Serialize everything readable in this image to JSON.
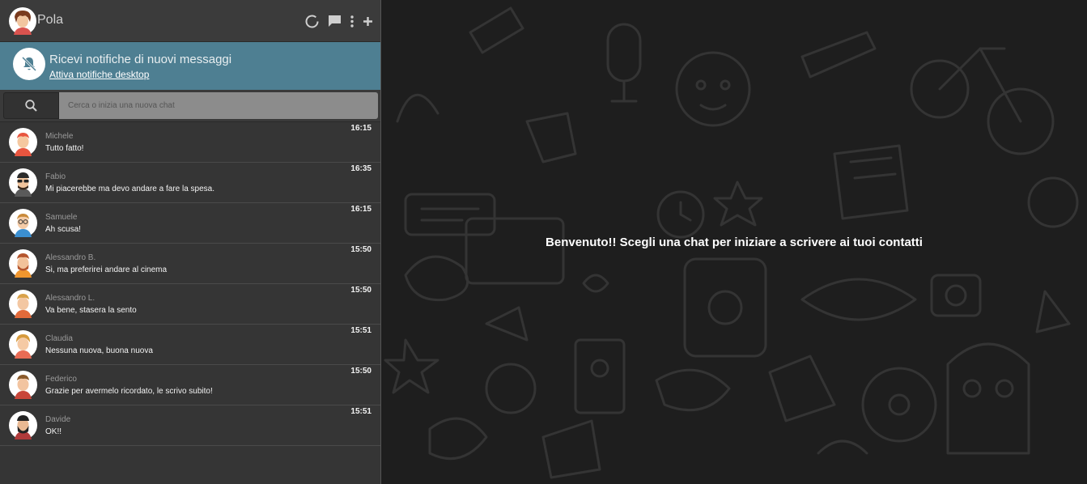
{
  "header": {
    "title": "Pola",
    "icons": [
      "status-icon",
      "chat-icon",
      "menu-icon",
      "add-icon"
    ]
  },
  "notification": {
    "title": "Ricevi notifiche di nuovi messaggi",
    "link": "Attiva notifiche desktop",
    "icon": "bell-off-icon"
  },
  "search": {
    "placeholder": "Cerca o inizia una nuova chat",
    "icon": "search-icon"
  },
  "chats": [
    {
      "name": "Michele",
      "message": "Tutto fatto!",
      "time": "16:15"
    },
    {
      "name": "Fabio",
      "message": "Mi piacerebbe ma devo andare a fare la spesa.",
      "time": "16:35"
    },
    {
      "name": "Samuele",
      "message": "Ah scusa!",
      "time": "16:15"
    },
    {
      "name": "Alessandro B.",
      "message": "Si, ma preferirei andare al cinema",
      "time": "15:50"
    },
    {
      "name": "Alessandro L.",
      "message": "Va bene, stasera la sento",
      "time": "15:50"
    },
    {
      "name": "Claudia",
      "message": "Nessuna nuova, buona nuova",
      "time": "15:51"
    },
    {
      "name": "Federico",
      "message": "Grazie per avermelo ricordato, le scrivo subito!",
      "time": "15:50"
    },
    {
      "name": "Davide",
      "message": "OK!!",
      "time": "15:51"
    }
  ],
  "main": {
    "welcome": "Benvenuto!! Scegli una chat per iniziare a scrivere ai tuoi contatti"
  },
  "colors": {
    "sidebar": "#353535",
    "notification": "#4e7f92",
    "main_bg": "#1e1e1e"
  }
}
